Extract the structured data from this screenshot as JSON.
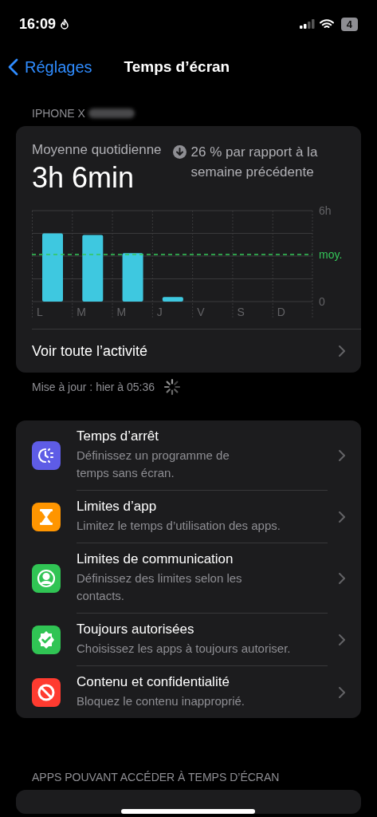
{
  "status_bar": {
    "time": "16:09",
    "battery": "4"
  },
  "nav": {
    "back": "Réglages",
    "title": "Temps d’écran"
  },
  "device_header": "IPHONE X",
  "summary": {
    "label": "Moyenne quotidienne",
    "value": "3h 6min",
    "trend": "26 % par rapport à la semaine précédente",
    "chart_data": {
      "type": "bar",
      "categories": [
        "L",
        "M",
        "M",
        "J",
        "V",
        "S",
        "D"
      ],
      "series": [
        {
          "color": "#3ec8e0",
          "values": [
            4.5,
            4.4,
            3.2,
            0.3,
            null,
            null,
            null
          ]
        }
      ],
      "ylim": [
        0,
        6
      ],
      "yticks": [
        {
          "value": 0,
          "label": "0"
        },
        {
          "value": 6,
          "label": "6h"
        }
      ],
      "ref_lines": [
        {
          "axis": "y",
          "value": 3.1,
          "label": "moy.",
          "color": "#34c759"
        }
      ]
    },
    "link": "Voir toute l’activité"
  },
  "updated": "Mise à jour : hier à 05:36",
  "settings": [
    {
      "kind": "downtime",
      "title": "Temps d’arrêt",
      "subtitle": "Définissez un programme de temps sans écran.",
      "color": "#5e5ce6"
    },
    {
      "kind": "app_limits",
      "title": "Limites d’app",
      "subtitle": "Limitez le temps d’utilisation des apps.",
      "color": "#ff9500"
    },
    {
      "kind": "communication",
      "title": "Limites de communication",
      "subtitle": "Définissez des limites selon les contacts.",
      "color": "#30c454"
    },
    {
      "kind": "always_allowed",
      "title": "Toujours autorisées",
      "subtitle": "Choisissez les apps à toujours autoriser.",
      "color": "#30c454"
    },
    {
      "kind": "content",
      "title": "Contenu et confidentialité",
      "subtitle": "Bloquez le contenu inapproprié.",
      "color": "#ff3b30"
    }
  ],
  "apps_header": "APPS POUVANT ACCÉDER À TEMPS D’ÉCRAN"
}
